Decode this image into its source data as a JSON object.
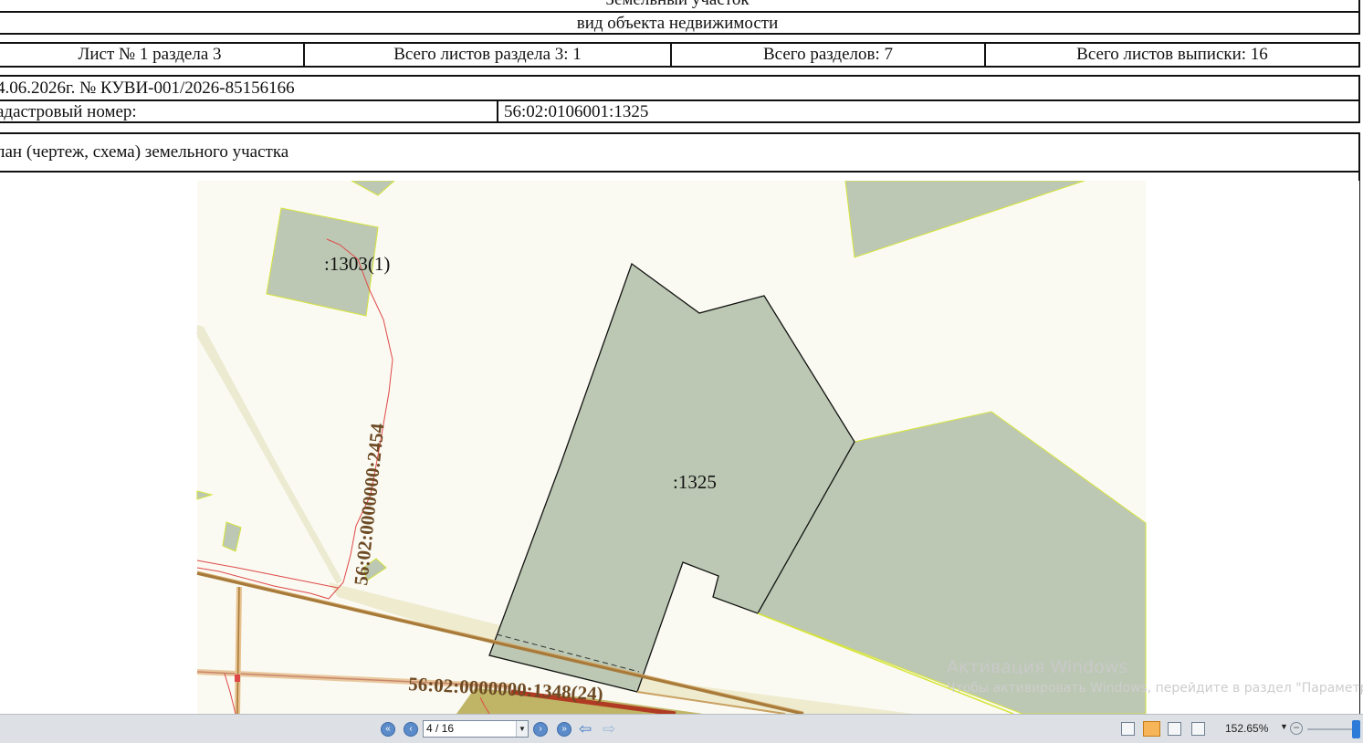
{
  "header": {
    "object_type": "Земельный участок",
    "object_kind_label": "вид объекта недвижимости"
  },
  "sheet_info": {
    "sheet": "Лист № 1 раздела 3",
    "section_sheets": "Всего листов раздела 3: 1",
    "sections": "Всего разделов: 7",
    "extract_sheets": "Всего листов выписки: 16"
  },
  "doc": {
    "number": "4.06.2026г. № КУВИ-001/2026-85156166",
    "cadastral_label": "адастровый номер:",
    "cadastral_value": "56:02:0106001:1325"
  },
  "plan": {
    "title": "лан (чертеж, схема) земельного участка",
    "labels": {
      "p1303": ":1303(1)",
      "p1325": ":1325",
      "p2454": "56:02:0000000:2454",
      "p1348": "56:02:0000000:1348(24)"
    },
    "colors": {
      "parcel_fill": "#bcc8b3",
      "neighbor_border": "#d6e43a",
      "road_brown": "#a77a3a",
      "road_cream": "#ecead0",
      "boundary_red": "#e04848",
      "label_brown": "#6d4a24"
    }
  },
  "watermark": {
    "title": "Активация Windows",
    "subtitle": "Чтобы активировать Windows, перейдите в раздел \"Параметры\"."
  },
  "toolbar": {
    "page_field": "4 / 16",
    "zoom": "152.65%"
  }
}
